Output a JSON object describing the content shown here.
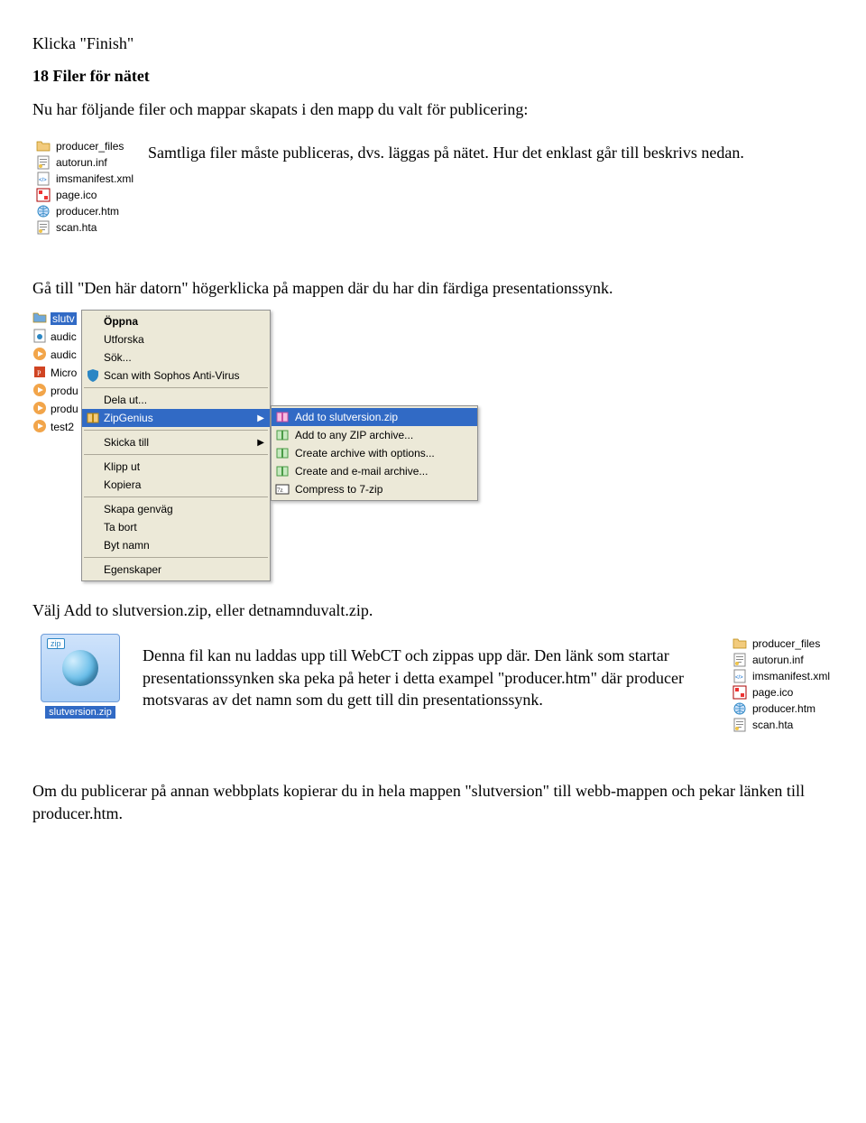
{
  "intro": {
    "line1": "Klicka \"Finish\"",
    "heading": "18 Filer för nätet",
    "line2": "Nu har följande filer och mappar skapats i den mapp du valt för publicering:"
  },
  "file_list": [
    {
      "icon": "folder",
      "label": "producer_files"
    },
    {
      "icon": "ini",
      "label": "autorun.inf"
    },
    {
      "icon": "xml",
      "label": "imsmanifest.xml"
    },
    {
      "icon": "ico",
      "label": "page.ico"
    },
    {
      "icon": "htm",
      "label": "producer.htm"
    },
    {
      "icon": "hta",
      "label": "scan.hta"
    }
  ],
  "para_after_list": {
    "p1": "Samtliga filer måste publiceras, dvs. läggas på nätet. Hur det enklast går till beskrivs nedan.",
    "p2": "Gå till \"Den här datorn\" högerklicka på mappen där du har din färdiga presentationssynk."
  },
  "side_files": [
    {
      "icon": "folder-sel",
      "label": "slutv"
    },
    {
      "icon": "wav",
      "label": "audic"
    },
    {
      "icon": "wmp",
      "label": "audic"
    },
    {
      "icon": "ppt",
      "label": "Micro"
    },
    {
      "icon": "wmp",
      "label": "produ"
    },
    {
      "icon": "wmp",
      "label": "produ"
    },
    {
      "icon": "wmp",
      "label": "test2"
    }
  ],
  "context_menu": {
    "items": [
      {
        "label": "Öppna",
        "bold": true
      },
      {
        "label": "Utforska"
      },
      {
        "label": "Sök..."
      },
      {
        "label": "Scan with Sophos Anti-Virus",
        "icon": "shield"
      },
      {
        "sep": true
      },
      {
        "label": "Dela ut..."
      },
      {
        "label": "ZipGenius",
        "icon": "zip",
        "submenu": true,
        "highlight": true
      },
      {
        "sep": true
      },
      {
        "label": "Skicka till",
        "submenu": true
      },
      {
        "sep": true
      },
      {
        "label": "Klipp ut"
      },
      {
        "label": "Kopiera"
      },
      {
        "sep": true
      },
      {
        "label": "Skapa genväg"
      },
      {
        "label": "Ta bort"
      },
      {
        "label": "Byt namn"
      },
      {
        "sep": true
      },
      {
        "label": "Egenskaper"
      }
    ],
    "submenu": [
      {
        "label": "Add to slutversion.zip",
        "icon": "zip-pink",
        "highlight": true
      },
      {
        "label": "Add to any ZIP archive...",
        "icon": "zip-green"
      },
      {
        "label": "Create archive with options...",
        "icon": "zip-green"
      },
      {
        "label": "Create and e-mail archive...",
        "icon": "zip-green"
      },
      {
        "label": "Compress to 7-zip",
        "icon": "7z"
      }
    ]
  },
  "after_menu": {
    "line": "Välj Add to slutversion.zip, eller detnamnduvalt.zip."
  },
  "zip_thumb": {
    "label": "slutversion.zip",
    "badge": "zip"
  },
  "zip_paragraph": "Denna fil kan nu laddas upp till WebCT och zippas upp där. Den länk som startar presentationssynken ska peka på heter i detta exampel \"producer.htm\" där producer motsvaras av det namn som du gett till din presentationssynk.",
  "footer": "Om du publicerar på annan webbplats kopierar du in hela mappen \"slutversion\" till webb-mappen och pekar länken till producer.htm."
}
